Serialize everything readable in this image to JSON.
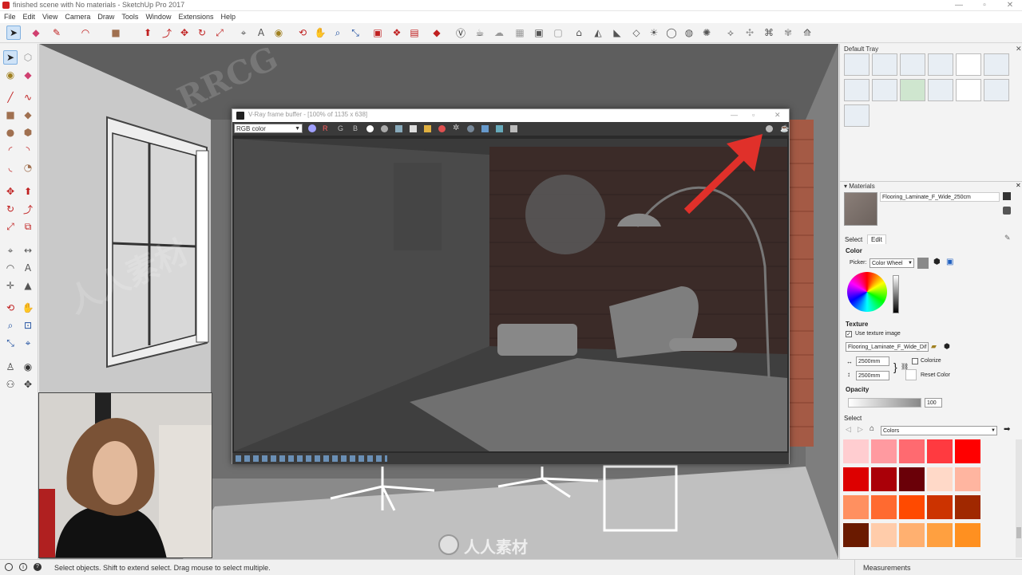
{
  "window": {
    "title": "finished scene with No materials - SketchUp Pro 2017"
  },
  "menu": [
    "File",
    "Edit",
    "View",
    "Camera",
    "Draw",
    "Tools",
    "Window",
    "Extensions",
    "Help"
  ],
  "vray": {
    "title": "V-Ray frame buffer - [100% of 1135 x 638]",
    "channel": "RGB color",
    "r": "R",
    "g": "G",
    "b": "B"
  },
  "tray": {
    "title": "Default Tray",
    "materials_title": "Materials",
    "material_name": "Flooring_Laminate_F_Wide_250cm",
    "tab_select": "Select",
    "tab_edit": "Edit",
    "color_label": "Color",
    "picker_label": "Picker:",
    "picker_value": "Color Wheel",
    "texture_label": "Texture",
    "use_texture": "Use texture image",
    "texture_file": "Flooring_Laminate_F_Wide_Dif",
    "width": "2500mm",
    "height": "2500mm",
    "colorize": "Colorize",
    "reset_color": "Reset Color",
    "opacity_label": "Opacity",
    "opacity_value": "100",
    "select_title": "Select",
    "library": "Colors",
    "swatches": [
      "#ffcdd0",
      "#ff9aa0",
      "#ff6a70",
      "#ff3a40",
      "#ff0000",
      "#dd0000",
      "#aa0008",
      "#6a0008",
      "#ffd9c8",
      "#ffb5a0",
      "#ff9060",
      "#ff6a30",
      "#ff4a00",
      "#cc3300",
      "#a02800",
      "#6a1a00",
      "#ffccaa",
      "#ffb070",
      "#ffa040",
      "#ff9020"
    ]
  },
  "status": {
    "hint": "Select objects. Shift to extend select. Drag mouse to select multiple.",
    "measurements": "Measurements"
  },
  "watermark": {
    "brand": "RRCG",
    "cn": "人人素材"
  }
}
